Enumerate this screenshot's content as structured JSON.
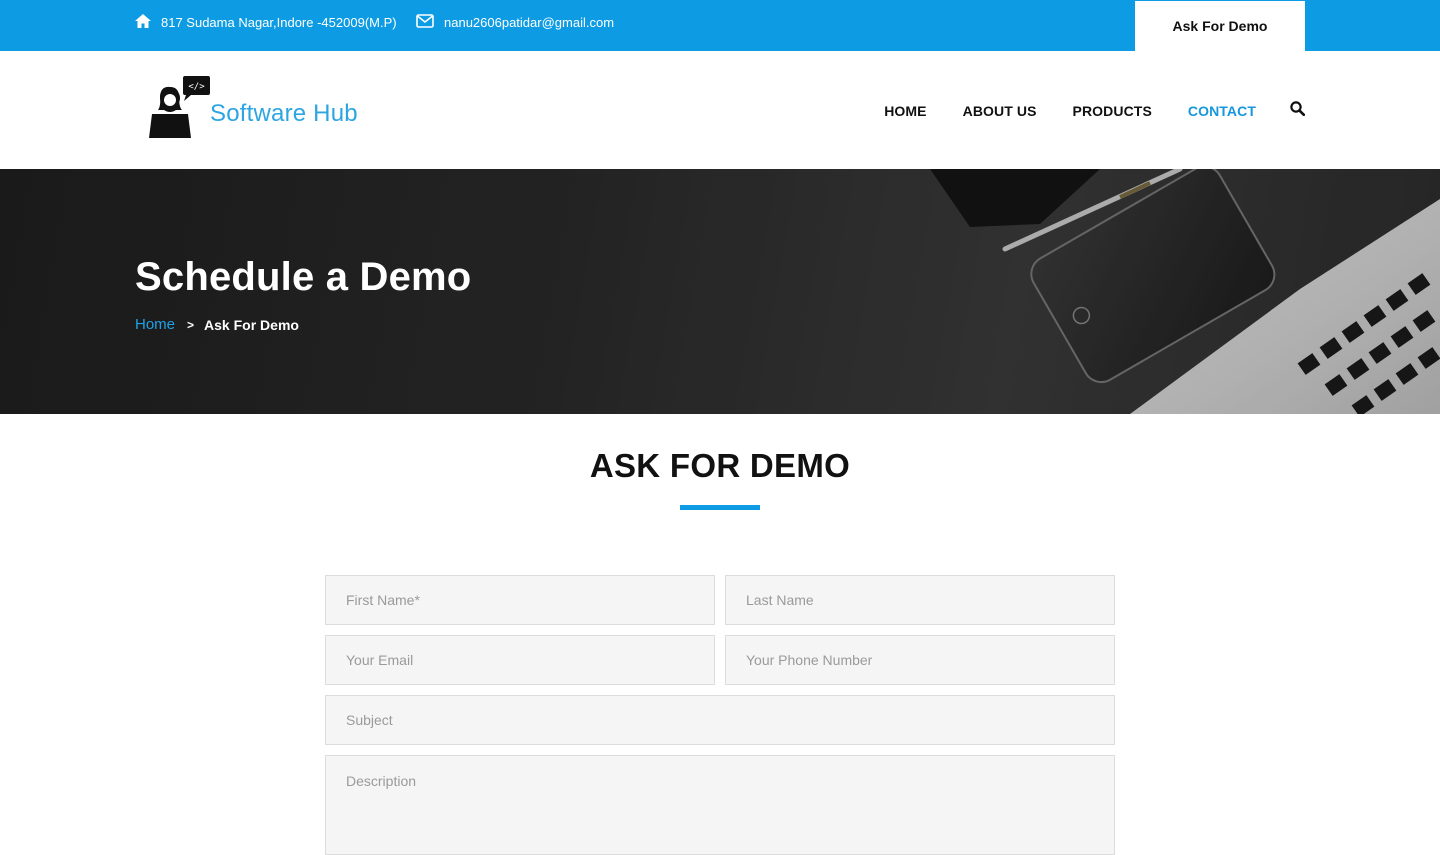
{
  "topbar": {
    "address": "817 Sudama Nagar,Indore -452009(M.P)",
    "email": "nanu2606patidar@gmail.com",
    "demo_button": "Ask For Demo"
  },
  "header": {
    "logo_text": "Software Hub",
    "nav": [
      "HOME",
      "ABOUT US",
      "PRODUCTS",
      "CONTACT"
    ],
    "active_nav": "CONTACT"
  },
  "hero": {
    "title": "Schedule a Demo",
    "breadcrumb_home": "Home",
    "breadcrumb_sep": ">",
    "breadcrumb_current": "Ask For Demo"
  },
  "section": {
    "title": "ASK FOR DEMO"
  },
  "form": {
    "first_name_placeholder": "First Name*",
    "last_name_placeholder": "Last Name",
    "email_placeholder": "Your Email",
    "phone_placeholder": "Your Phone Number",
    "subject_placeholder": "Subject",
    "description_placeholder": "Description"
  },
  "colors": {
    "accent": "#0d9ce3",
    "logo_text": "#2da5e3"
  },
  "icons": {
    "address": "home-icon",
    "email": "envelope-icon",
    "search": "search-icon"
  }
}
